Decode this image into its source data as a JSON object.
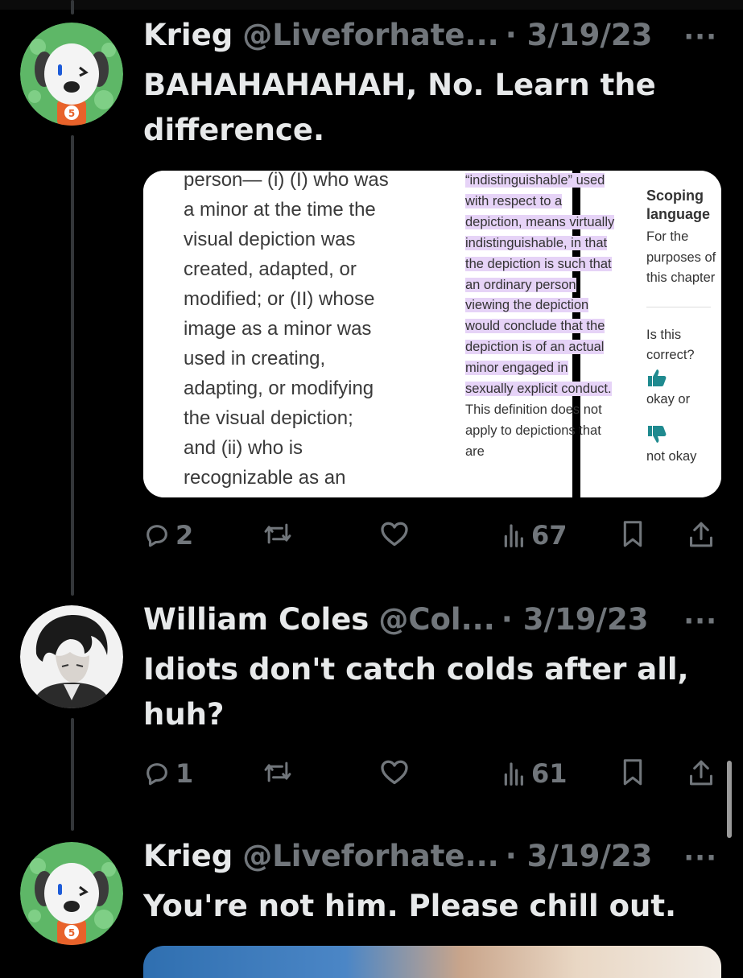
{
  "tweets": [
    {
      "name": "Krieg",
      "handle": "@Liveforhate...",
      "date": "· 3/19/23",
      "text": "BAHAHAHAHAH, No. Learn the difference.",
      "replies": "2",
      "views": "67",
      "media": {
        "left_text": "person— (i) (I) who was\na minor at the time the\nvisual depiction was\ncreated, adapted, or\nmodified; or (II) whose\nimage as a minor was\nused in creating,\nadapting, or modifying\nthe visual depiction;\nand (ii) who is\nrecognizable as an\nactual person by the",
        "right_highlight": "“indistinguishable” used with respect to a depiction, means virtually indistinguishable, in that the depiction is such that an ordinary person viewing the depiction would conclude that the depiction is of an actual minor engaged in sexually explicit conduct.",
        "right_plain": " This definition does not apply to depictions that are",
        "side_title": "Scoping language",
        "side_body": "For the purposes of this chapter",
        "side_question": "Is this correct?",
        "side_okay": "okay or",
        "side_not_okay": "not okay"
      }
    },
    {
      "name": "William Coles",
      "handle": "@Col...",
      "date": "· 3/19/23",
      "text": "Idiots don't catch colds after all, huh?",
      "replies": "1",
      "views": "61"
    },
    {
      "name": "Krieg",
      "handle": "@Liveforhate...",
      "date": "· 3/19/23",
      "text": "You're not him. Please chill out."
    }
  ],
  "more_label": "···",
  "colors": {
    "background": "#000000",
    "text": "#e7e9ea",
    "secondary": "#71767b",
    "highlight": "#e6d3f7",
    "thread_line": "#333639"
  }
}
